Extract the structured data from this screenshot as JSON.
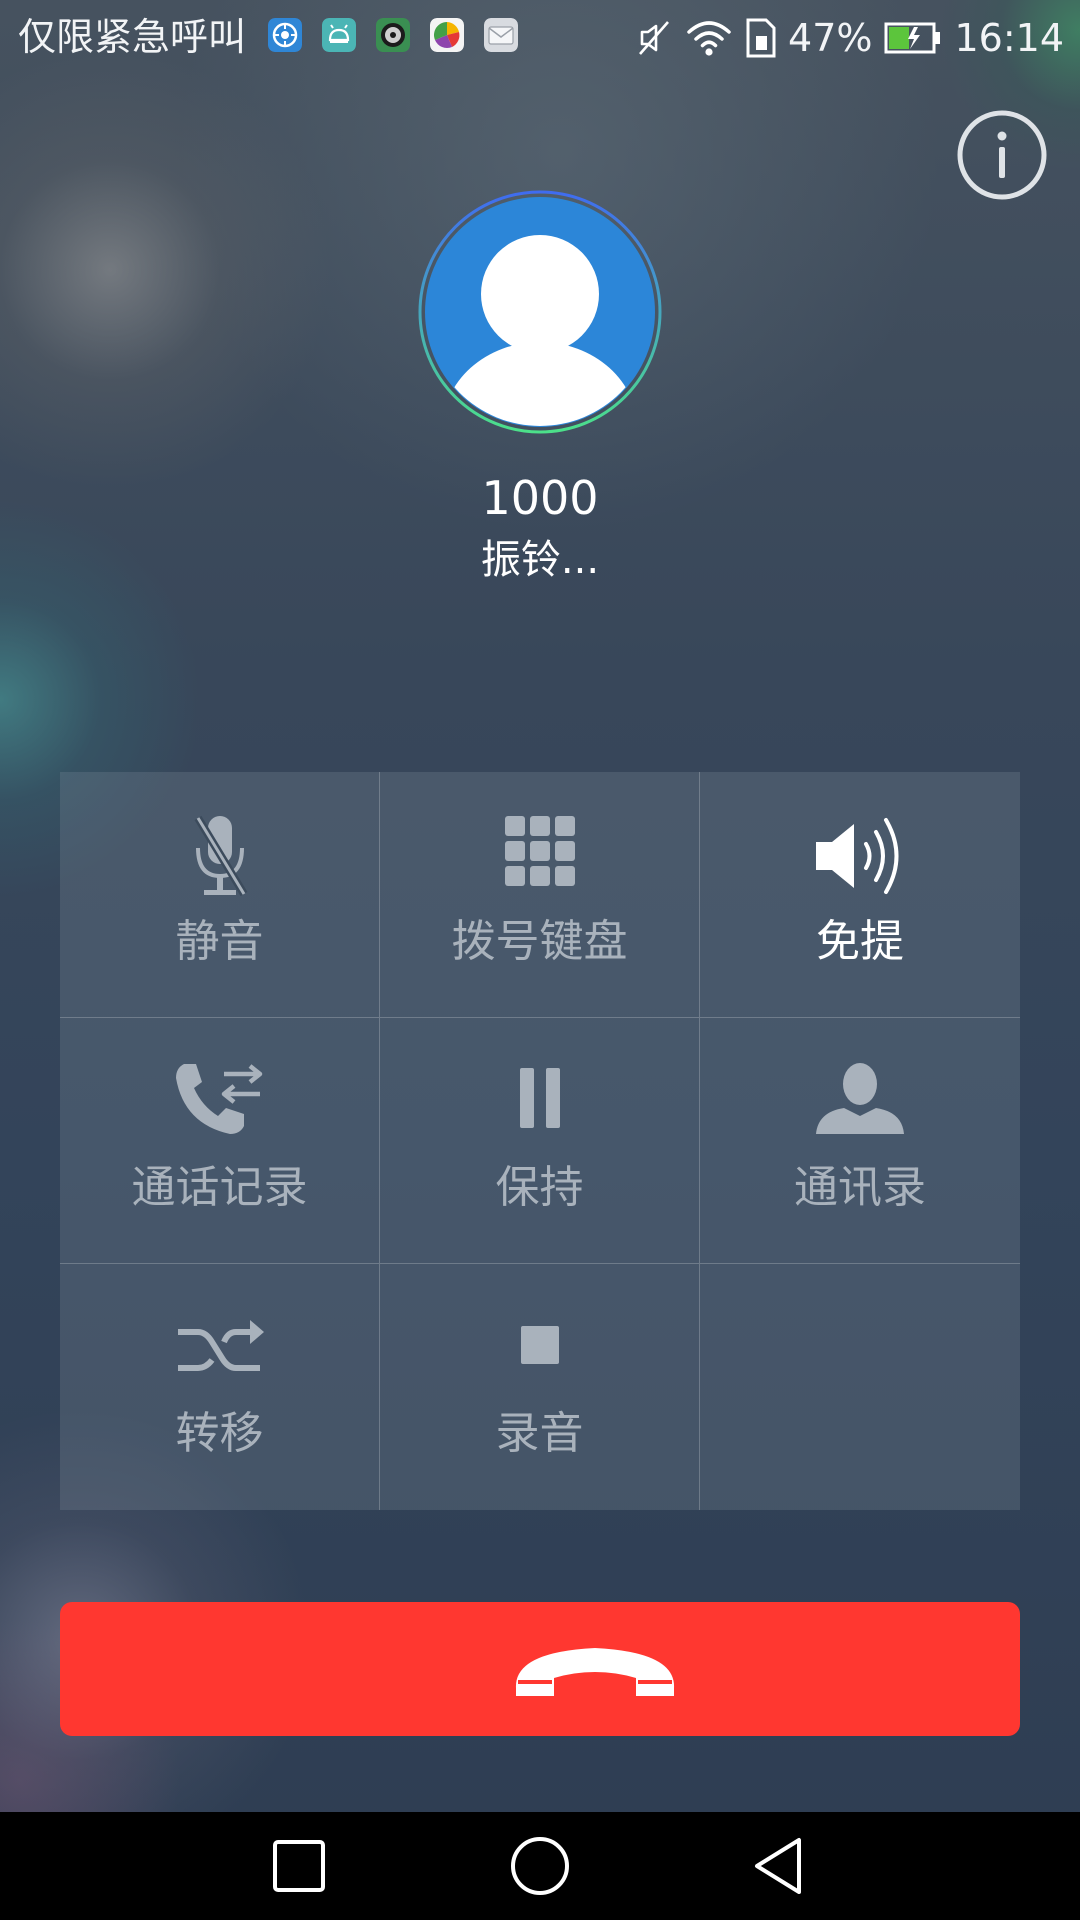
{
  "status_bar": {
    "carrier_text": "仅限紧急呼叫",
    "battery_percent": "47%",
    "battery_level": 0.47,
    "time": "16:14",
    "notification_icons": [
      "app-notification-icon-1",
      "android-icon",
      "app-notification-icon-3",
      "app-notification-icon-4",
      "email-icon"
    ],
    "indicators": [
      "vibrate-off-icon",
      "wifi-icon",
      "sim-card-icon",
      "battery-charging-icon"
    ]
  },
  "info_button": {
    "icon": "info-icon"
  },
  "caller": {
    "avatar_icon": "default-contact-avatar-icon",
    "number": "1000",
    "status": "振铃..."
  },
  "controls": [
    {
      "label": "静音",
      "icon": "microphone-muted-icon",
      "active": false
    },
    {
      "label": "拨号键盘",
      "icon": "dialpad-icon",
      "active": false
    },
    {
      "label": "免提",
      "icon": "speaker-icon",
      "active": true
    },
    {
      "label": "通话记录",
      "icon": "call-log-icon",
      "active": false
    },
    {
      "label": "保持",
      "icon": "pause-icon",
      "active": false
    },
    {
      "label": "通讯录",
      "icon": "contacts-icon",
      "active": false
    },
    {
      "label": "转移",
      "icon": "transfer-icon",
      "active": false
    },
    {
      "label": "录音",
      "icon": "record-stop-icon",
      "active": false
    }
  ],
  "end_call": {
    "icon": "end-call-icon",
    "color": "#ff3730"
  },
  "nav_bar": {
    "buttons": [
      "recent-apps-icon",
      "home-icon",
      "back-icon"
    ]
  },
  "colors": {
    "accent_avatar": "#2c86d8",
    "inactive_control": "#a9b2bc",
    "active_control": "#ffffff",
    "battery_fill": "#5cc53c"
  }
}
